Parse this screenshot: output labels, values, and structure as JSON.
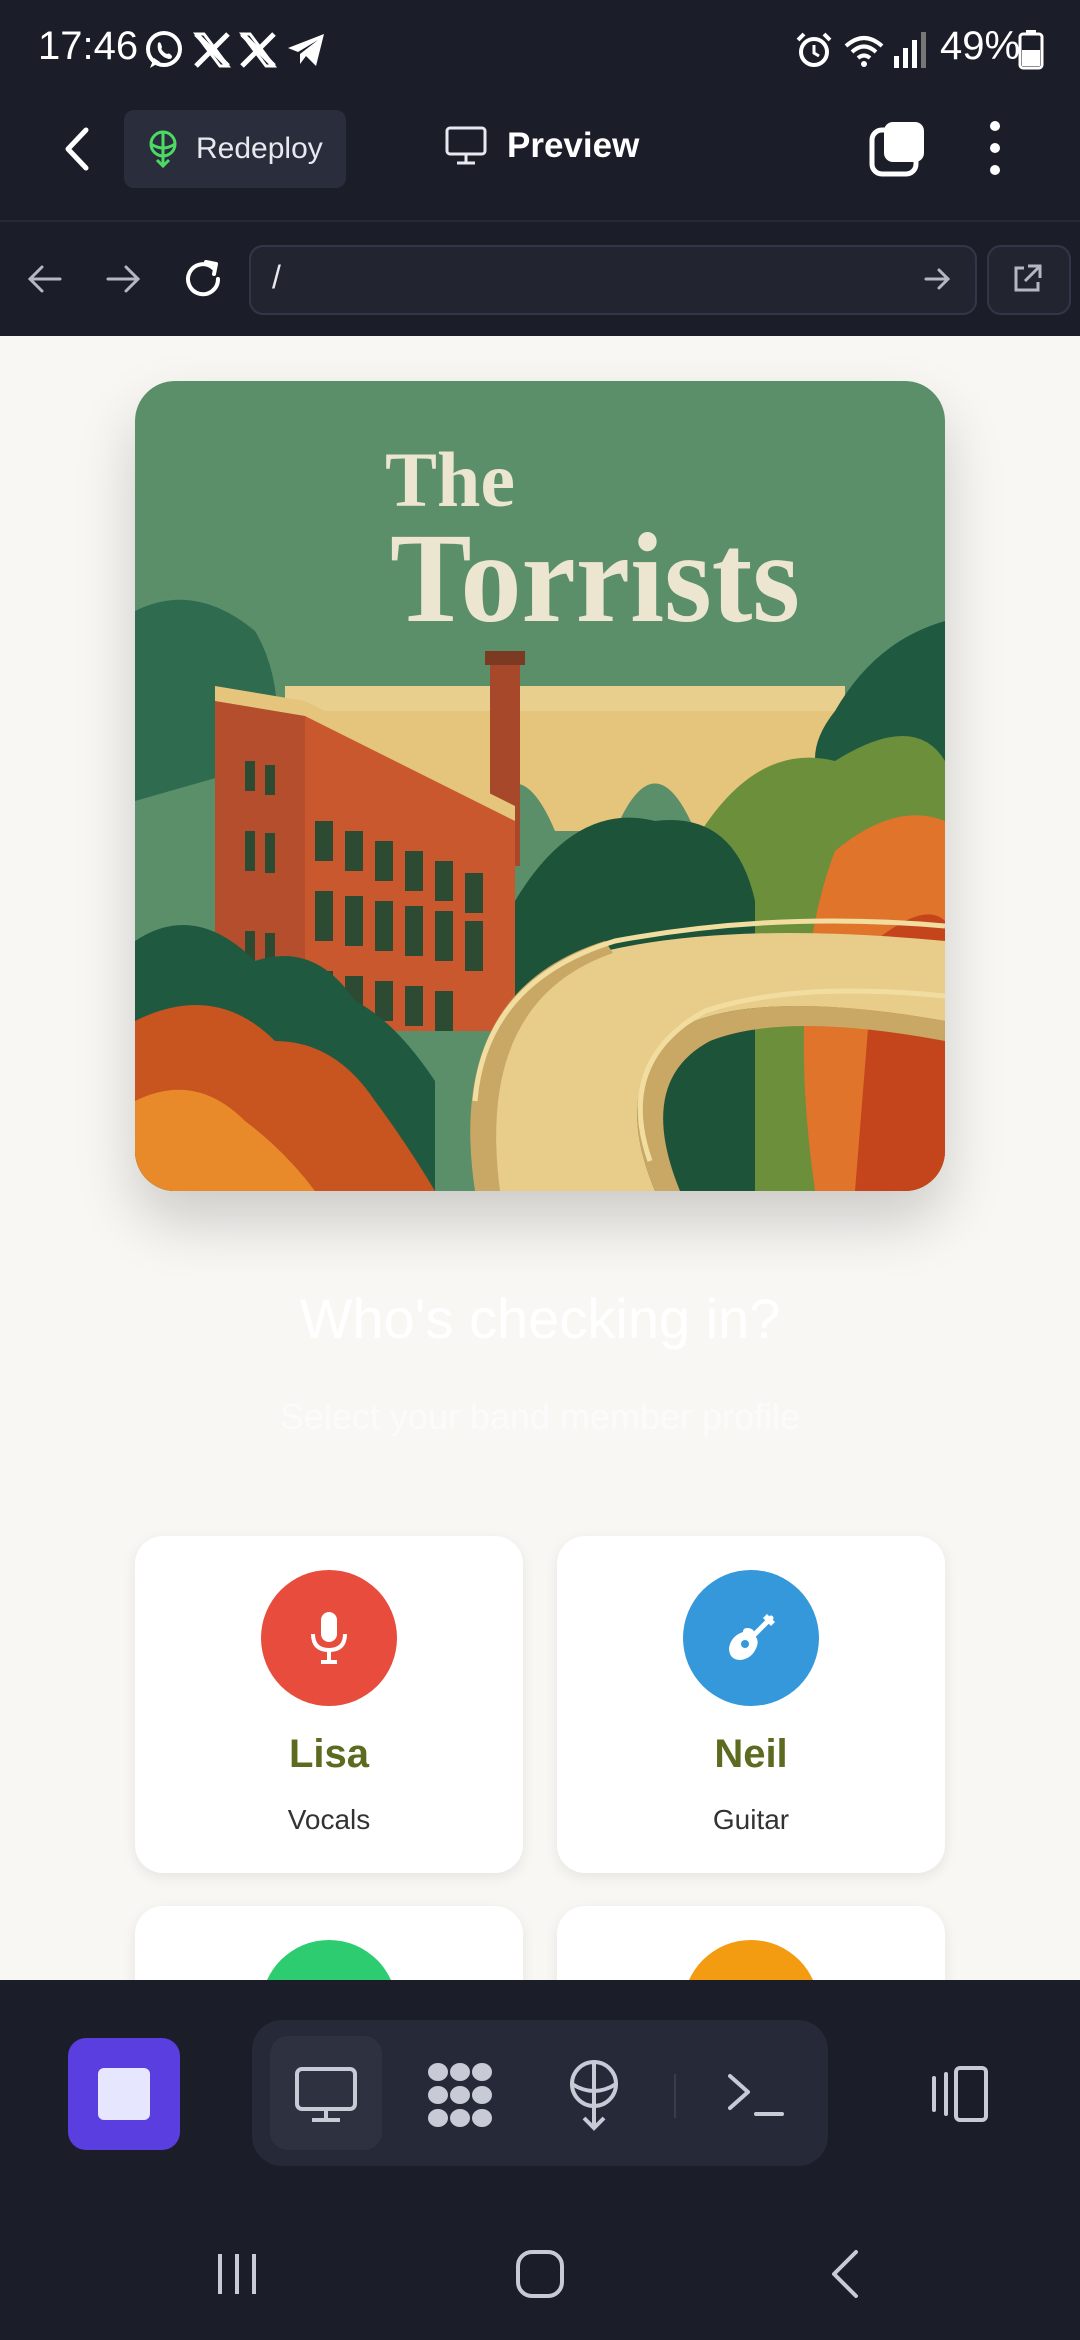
{
  "status_bar": {
    "time": "17:46",
    "battery": "49%",
    "notification_icons": [
      "whatsapp-icon",
      "x-icon",
      "x-icon",
      "telegram-icon"
    ],
    "system_icons": [
      "alarm-icon",
      "wifi-icon",
      "signal-icon",
      "battery-icon"
    ]
  },
  "app_header": {
    "redeploy_label": "Redeploy",
    "title": "Preview"
  },
  "browser": {
    "url": "/"
  },
  "artwork": {
    "title_line1": "The",
    "title_line2": "Torrists"
  },
  "page": {
    "heading": "Who's checking in?",
    "subheading": "Select your band member profile"
  },
  "members": [
    {
      "name": "Lisa",
      "role": "Vocals",
      "color": "#e74c3c",
      "icon": "microphone-icon"
    },
    {
      "name": "Neil",
      "role": "Guitar",
      "color": "#3498db",
      "icon": "guitar-icon"
    },
    {
      "color": "#2ecc71"
    },
    {
      "color": "#f39c12"
    }
  ],
  "colors": {
    "accent": "#5b3ee0",
    "background": "#1b1d29",
    "member_name": "#5c6b1f"
  }
}
